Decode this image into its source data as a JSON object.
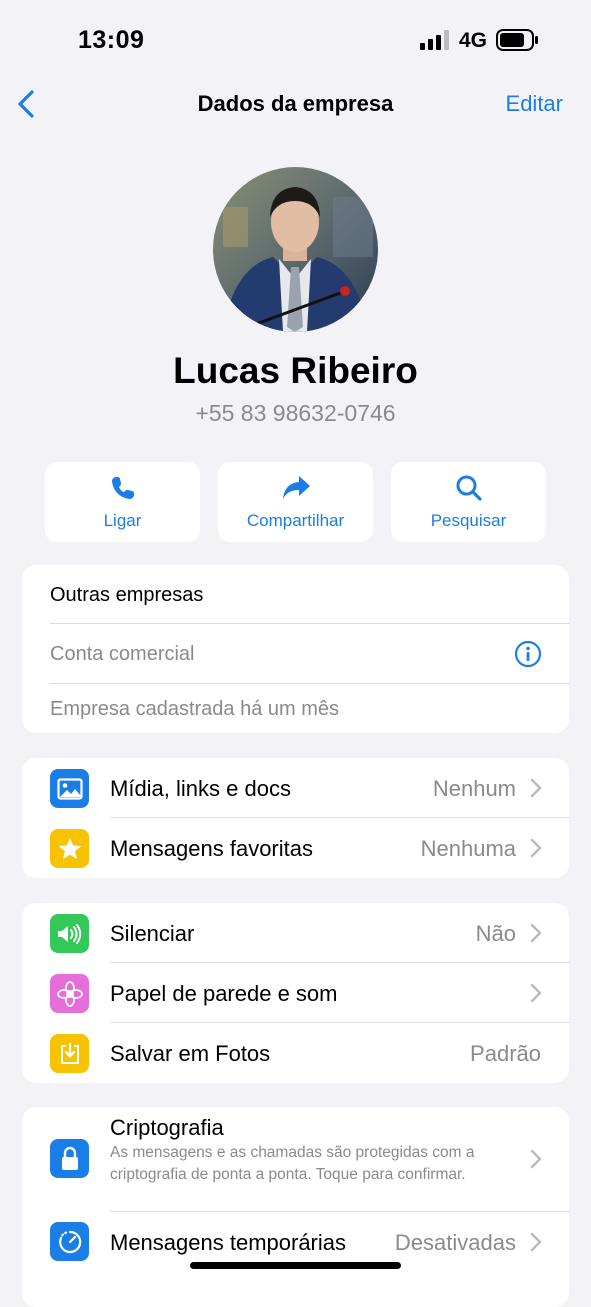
{
  "status": {
    "time": "13:09",
    "network": "4G"
  },
  "nav": {
    "title": "Dados da empresa",
    "edit_label": "Editar"
  },
  "profile": {
    "name": "Lucas Ribeiro",
    "phone": "+55 83 98632-0746"
  },
  "actions": [
    {
      "label": "Ligar",
      "icon": "phone-icon"
    },
    {
      "label": "Compartilhar",
      "icon": "share-arrow-icon"
    },
    {
      "label": "Pesquisar",
      "icon": "search-icon"
    }
  ],
  "business": {
    "category": "Outras empresas",
    "account_type": "Conta comercial",
    "registered": "Empresa cadastrada há um mês"
  },
  "media_section": [
    {
      "label": "Mídia, links e docs",
      "value": "Nenhum",
      "icon": "photo-icon",
      "color": "#1a7ee6"
    },
    {
      "label": "Mensagens favoritas",
      "value": "Nenhuma",
      "icon": "star-icon",
      "color": "#f7c300"
    }
  ],
  "settings_section": [
    {
      "label": "Silenciar",
      "value": "Não",
      "icon": "speaker-icon",
      "color": "#34c759"
    },
    {
      "label": "Papel de parede e som",
      "value": "",
      "icon": "flower-icon",
      "color": "#e56ed8"
    },
    {
      "label": "Salvar em Fotos",
      "value": "Padrão",
      "icon": "save-download-icon",
      "color": "#f7c300"
    }
  ],
  "privacy_section": {
    "encryption": {
      "label": "Criptografia",
      "description": "As mensagens e as chamadas são protegidas com a criptografia de ponta a ponta. Toque para confirmar.",
      "icon": "lock-icon",
      "color": "#1a7ee6"
    },
    "disappearing": {
      "label": "Mensagens temporárias",
      "value": "Desativadas",
      "icon": "timer-icon",
      "color": "#1a7ee6"
    }
  },
  "colors": {
    "accent": "#1a7ee6",
    "background": "#f2f2f7",
    "secondary_text": "#8a8a8e"
  }
}
